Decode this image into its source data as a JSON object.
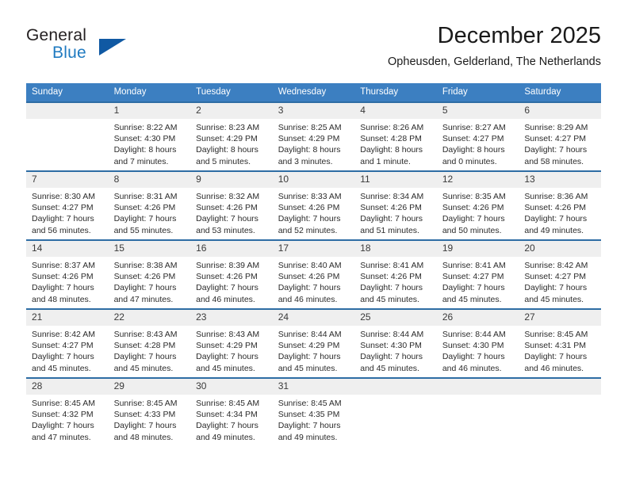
{
  "brand": {
    "name_top": "General",
    "name_bottom": "Blue",
    "flag_icon": "triangle-flag-icon"
  },
  "header": {
    "title": "December 2025",
    "location": "Opheusden, Gelderland, The Netherlands"
  },
  "colors": {
    "header_blue": "#3c7fc1",
    "row_divider_blue": "#2e6da4",
    "daynum_band": "#efefef",
    "brand_blue": "#1f7ac0",
    "brand_flag": "#1059a3"
  },
  "weekdays": [
    "Sunday",
    "Monday",
    "Tuesday",
    "Wednesday",
    "Thursday",
    "Friday",
    "Saturday"
  ],
  "weeks": [
    [
      {
        "day": "",
        "sunrise": "",
        "sunset": "",
        "daylight_line1": "",
        "daylight_line2": "",
        "blank": true
      },
      {
        "day": "1",
        "sunrise": "Sunrise: 8:22 AM",
        "sunset": "Sunset: 4:30 PM",
        "daylight_line1": "Daylight: 8 hours",
        "daylight_line2": "and 7 minutes.",
        "blank": false
      },
      {
        "day": "2",
        "sunrise": "Sunrise: 8:23 AM",
        "sunset": "Sunset: 4:29 PM",
        "daylight_line1": "Daylight: 8 hours",
        "daylight_line2": "and 5 minutes.",
        "blank": false
      },
      {
        "day": "3",
        "sunrise": "Sunrise: 8:25 AM",
        "sunset": "Sunset: 4:29 PM",
        "daylight_line1": "Daylight: 8 hours",
        "daylight_line2": "and 3 minutes.",
        "blank": false
      },
      {
        "day": "4",
        "sunrise": "Sunrise: 8:26 AM",
        "sunset": "Sunset: 4:28 PM",
        "daylight_line1": "Daylight: 8 hours",
        "daylight_line2": "and 1 minute.",
        "blank": false
      },
      {
        "day": "5",
        "sunrise": "Sunrise: 8:27 AM",
        "sunset": "Sunset: 4:27 PM",
        "daylight_line1": "Daylight: 8 hours",
        "daylight_line2": "and 0 minutes.",
        "blank": false
      },
      {
        "day": "6",
        "sunrise": "Sunrise: 8:29 AM",
        "sunset": "Sunset: 4:27 PM",
        "daylight_line1": "Daylight: 7 hours",
        "daylight_line2": "and 58 minutes.",
        "blank": false
      }
    ],
    [
      {
        "day": "7",
        "sunrise": "Sunrise: 8:30 AM",
        "sunset": "Sunset: 4:27 PM",
        "daylight_line1": "Daylight: 7 hours",
        "daylight_line2": "and 56 minutes.",
        "blank": false
      },
      {
        "day": "8",
        "sunrise": "Sunrise: 8:31 AM",
        "sunset": "Sunset: 4:26 PM",
        "daylight_line1": "Daylight: 7 hours",
        "daylight_line2": "and 55 minutes.",
        "blank": false
      },
      {
        "day": "9",
        "sunrise": "Sunrise: 8:32 AM",
        "sunset": "Sunset: 4:26 PM",
        "daylight_line1": "Daylight: 7 hours",
        "daylight_line2": "and 53 minutes.",
        "blank": false
      },
      {
        "day": "10",
        "sunrise": "Sunrise: 8:33 AM",
        "sunset": "Sunset: 4:26 PM",
        "daylight_line1": "Daylight: 7 hours",
        "daylight_line2": "and 52 minutes.",
        "blank": false
      },
      {
        "day": "11",
        "sunrise": "Sunrise: 8:34 AM",
        "sunset": "Sunset: 4:26 PM",
        "daylight_line1": "Daylight: 7 hours",
        "daylight_line2": "and 51 minutes.",
        "blank": false
      },
      {
        "day": "12",
        "sunrise": "Sunrise: 8:35 AM",
        "sunset": "Sunset: 4:26 PM",
        "daylight_line1": "Daylight: 7 hours",
        "daylight_line2": "and 50 minutes.",
        "blank": false
      },
      {
        "day": "13",
        "sunrise": "Sunrise: 8:36 AM",
        "sunset": "Sunset: 4:26 PM",
        "daylight_line1": "Daylight: 7 hours",
        "daylight_line2": "and 49 minutes.",
        "blank": false
      }
    ],
    [
      {
        "day": "14",
        "sunrise": "Sunrise: 8:37 AM",
        "sunset": "Sunset: 4:26 PM",
        "daylight_line1": "Daylight: 7 hours",
        "daylight_line2": "and 48 minutes.",
        "blank": false
      },
      {
        "day": "15",
        "sunrise": "Sunrise: 8:38 AM",
        "sunset": "Sunset: 4:26 PM",
        "daylight_line1": "Daylight: 7 hours",
        "daylight_line2": "and 47 minutes.",
        "blank": false
      },
      {
        "day": "16",
        "sunrise": "Sunrise: 8:39 AM",
        "sunset": "Sunset: 4:26 PM",
        "daylight_line1": "Daylight: 7 hours",
        "daylight_line2": "and 46 minutes.",
        "blank": false
      },
      {
        "day": "17",
        "sunrise": "Sunrise: 8:40 AM",
        "sunset": "Sunset: 4:26 PM",
        "daylight_line1": "Daylight: 7 hours",
        "daylight_line2": "and 46 minutes.",
        "blank": false
      },
      {
        "day": "18",
        "sunrise": "Sunrise: 8:41 AM",
        "sunset": "Sunset: 4:26 PM",
        "daylight_line1": "Daylight: 7 hours",
        "daylight_line2": "and 45 minutes.",
        "blank": false
      },
      {
        "day": "19",
        "sunrise": "Sunrise: 8:41 AM",
        "sunset": "Sunset: 4:27 PM",
        "daylight_line1": "Daylight: 7 hours",
        "daylight_line2": "and 45 minutes.",
        "blank": false
      },
      {
        "day": "20",
        "sunrise": "Sunrise: 8:42 AM",
        "sunset": "Sunset: 4:27 PM",
        "daylight_line1": "Daylight: 7 hours",
        "daylight_line2": "and 45 minutes.",
        "blank": false
      }
    ],
    [
      {
        "day": "21",
        "sunrise": "Sunrise: 8:42 AM",
        "sunset": "Sunset: 4:27 PM",
        "daylight_line1": "Daylight: 7 hours",
        "daylight_line2": "and 45 minutes.",
        "blank": false
      },
      {
        "day": "22",
        "sunrise": "Sunrise: 8:43 AM",
        "sunset": "Sunset: 4:28 PM",
        "daylight_line1": "Daylight: 7 hours",
        "daylight_line2": "and 45 minutes.",
        "blank": false
      },
      {
        "day": "23",
        "sunrise": "Sunrise: 8:43 AM",
        "sunset": "Sunset: 4:29 PM",
        "daylight_line1": "Daylight: 7 hours",
        "daylight_line2": "and 45 minutes.",
        "blank": false
      },
      {
        "day": "24",
        "sunrise": "Sunrise: 8:44 AM",
        "sunset": "Sunset: 4:29 PM",
        "daylight_line1": "Daylight: 7 hours",
        "daylight_line2": "and 45 minutes.",
        "blank": false
      },
      {
        "day": "25",
        "sunrise": "Sunrise: 8:44 AM",
        "sunset": "Sunset: 4:30 PM",
        "daylight_line1": "Daylight: 7 hours",
        "daylight_line2": "and 45 minutes.",
        "blank": false
      },
      {
        "day": "26",
        "sunrise": "Sunrise: 8:44 AM",
        "sunset": "Sunset: 4:30 PM",
        "daylight_line1": "Daylight: 7 hours",
        "daylight_line2": "and 46 minutes.",
        "blank": false
      },
      {
        "day": "27",
        "sunrise": "Sunrise: 8:45 AM",
        "sunset": "Sunset: 4:31 PM",
        "daylight_line1": "Daylight: 7 hours",
        "daylight_line2": "and 46 minutes.",
        "blank": false
      }
    ],
    [
      {
        "day": "28",
        "sunrise": "Sunrise: 8:45 AM",
        "sunset": "Sunset: 4:32 PM",
        "daylight_line1": "Daylight: 7 hours",
        "daylight_line2": "and 47 minutes.",
        "blank": false
      },
      {
        "day": "29",
        "sunrise": "Sunrise: 8:45 AM",
        "sunset": "Sunset: 4:33 PM",
        "daylight_line1": "Daylight: 7 hours",
        "daylight_line2": "and 48 minutes.",
        "blank": false
      },
      {
        "day": "30",
        "sunrise": "Sunrise: 8:45 AM",
        "sunset": "Sunset: 4:34 PM",
        "daylight_line1": "Daylight: 7 hours",
        "daylight_line2": "and 49 minutes.",
        "blank": false
      },
      {
        "day": "31",
        "sunrise": "Sunrise: 8:45 AM",
        "sunset": "Sunset: 4:35 PM",
        "daylight_line1": "Daylight: 7 hours",
        "daylight_line2": "and 49 minutes.",
        "blank": false
      },
      {
        "day": "",
        "sunrise": "",
        "sunset": "",
        "daylight_line1": "",
        "daylight_line2": "",
        "blank": true
      },
      {
        "day": "",
        "sunrise": "",
        "sunset": "",
        "daylight_line1": "",
        "daylight_line2": "",
        "blank": true
      },
      {
        "day": "",
        "sunrise": "",
        "sunset": "",
        "daylight_line1": "",
        "daylight_line2": "",
        "blank": true
      }
    ]
  ]
}
